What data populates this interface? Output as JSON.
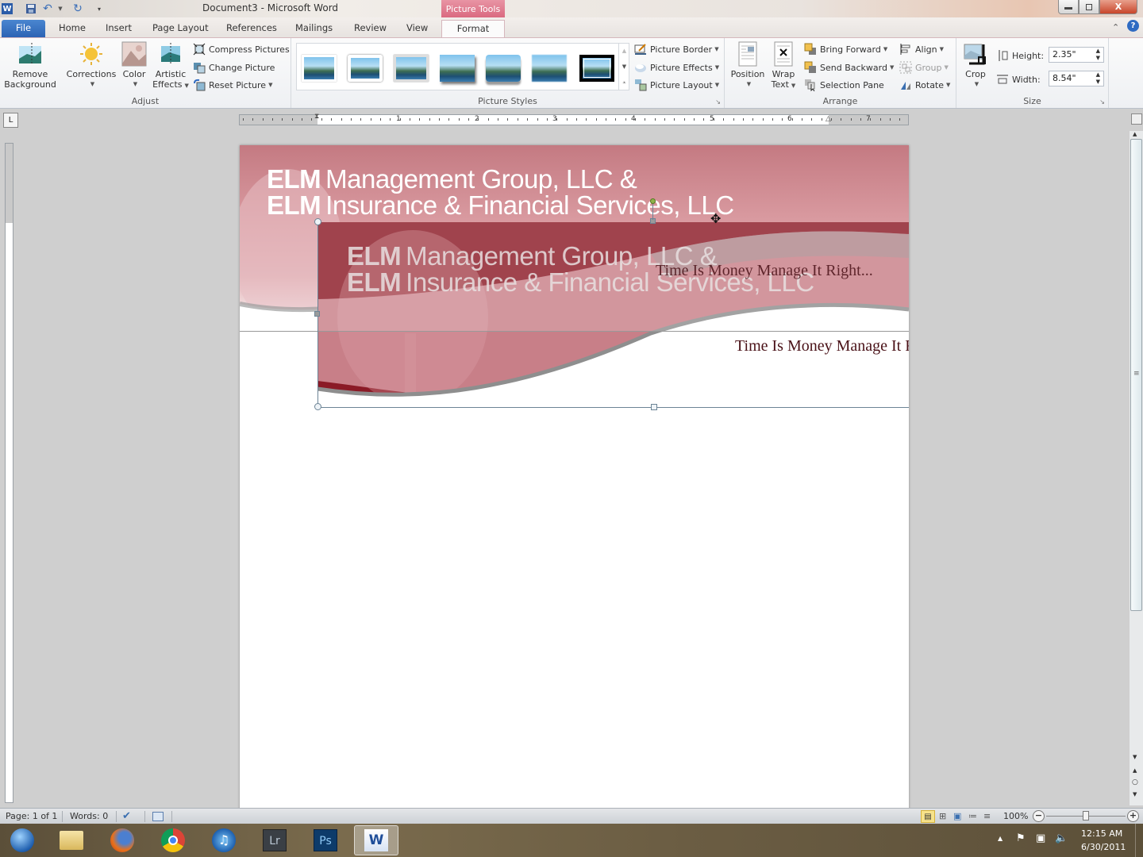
{
  "titlebar": {
    "title": "Document3 - Microsoft Word",
    "contextual_tab": "Picture Tools",
    "qat": {
      "word_icon": "word-app-icon",
      "save": "save-icon",
      "undo": "undo-icon",
      "redo": "redo-icon",
      "customize": "customize-qat-icon"
    },
    "window_buttons": {
      "minimize": "—",
      "restore": "❐",
      "close": "X"
    }
  },
  "tabs": [
    {
      "label": "File"
    },
    {
      "label": "Home"
    },
    {
      "label": "Insert"
    },
    {
      "label": "Page Layout"
    },
    {
      "label": "References"
    },
    {
      "label": "Mailings"
    },
    {
      "label": "Review"
    },
    {
      "label": "View"
    },
    {
      "label": "Format"
    }
  ],
  "ribbon": {
    "adjust": {
      "label": "Adjust",
      "remove_background": [
        "Remove",
        "Background"
      ],
      "corrections": "Corrections",
      "color": "Color",
      "artistic_effects": [
        "Artistic",
        "Effects"
      ],
      "compress_pictures": "Compress Pictures",
      "change_picture": "Change Picture",
      "reset_picture": "Reset Picture"
    },
    "picture_styles": {
      "label": "Picture Styles",
      "style_count": 7,
      "picture_border": "Picture Border",
      "picture_effects": "Picture Effects",
      "picture_layout": "Picture Layout"
    },
    "arrange": {
      "label": "Arrange",
      "position": "Position",
      "wrap_text": [
        "Wrap",
        "Text"
      ],
      "bring_forward": "Bring Forward",
      "send_backward": "Send Backward",
      "selection_pane": "Selection Pane",
      "align": "Align",
      "group": "Group",
      "rotate": "Rotate"
    },
    "size": {
      "label": "Size",
      "crop": "Crop",
      "height_label": "Height:",
      "height_value": "2.35\"",
      "width_label": "Width:",
      "width_value": "8.54\""
    }
  },
  "ruler": {
    "numbers": [
      "1",
      "1",
      "2",
      "3",
      "4",
      "5",
      "6",
      "7"
    ],
    "tab_selector": "L"
  },
  "document": {
    "header_line1_bold": "ELM",
    "header_line1": "Management Group, LLC &",
    "header_line2_bold": "ELM",
    "header_line2": "Insurance & Financial Services, LLC",
    "tagline_ghost": "Time Is Money Manage It Right...",
    "tagline": "Time Is Money Manage It R",
    "colors": {
      "maroon": "#8b1a26",
      "rose": "#c97780",
      "text_dark": "#4a1218"
    }
  },
  "statusbar": {
    "page": "Page: 1 of 1",
    "words": "Words: 0",
    "zoom": "100%",
    "zoom_fraction": 0.5
  },
  "taskbar": {
    "apps": [
      "start",
      "explorer",
      "firefox",
      "chrome",
      "itunes",
      "Lr",
      "Ps",
      "W"
    ],
    "time": "12:15 AM",
    "date": "6/30/2011"
  }
}
